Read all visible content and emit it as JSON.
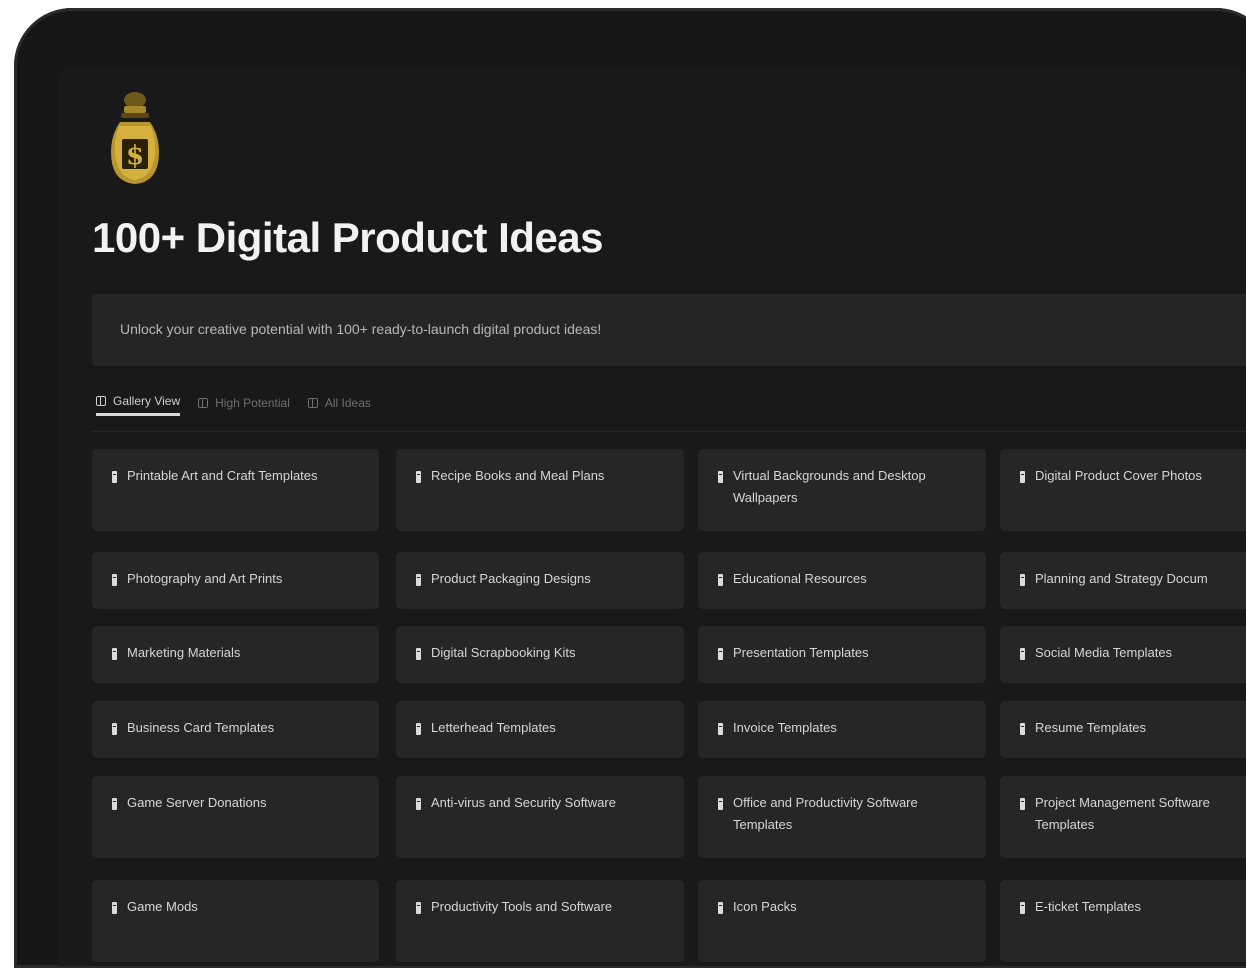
{
  "page": {
    "icon": "money-bag-icon",
    "title": "100+ Digital Product Ideas",
    "description": "Unlock your creative potential with 100+ ready-to-launch digital product ideas!"
  },
  "views": [
    {
      "label": "Gallery View",
      "active": true
    },
    {
      "label": "High Potential",
      "active": false
    },
    {
      "label": "All Ideas",
      "active": false
    }
  ],
  "cards": [
    "Printable Art and Craft Templates",
    "Recipe Books and Meal Plans",
    "Virtual Backgrounds and Desktop Wallpapers",
    "Digital Product Cover Photos",
    "Photography and Art Prints",
    "Product Packaging Designs",
    "Educational Resources",
    "Planning and Strategy Docum",
    "Marketing Materials",
    "Digital Scrapbooking Kits",
    "Presentation Templates",
    "Social Media Templates",
    "Business Card Templates",
    "Letterhead Templates",
    "Invoice Templates",
    "Resume Templates",
    "Game Server Donations",
    "Anti-virus and Security Software",
    "Office and Productivity Software Templates",
    "Project Management Software Templates",
    "Game Mods",
    "Productivity Tools and Software",
    "Icon Packs",
    "E-ticket Templates"
  ],
  "colors": {
    "background": "#191919",
    "card": "#262626",
    "callout": "#252525",
    "text": "#f2f2f2"
  }
}
